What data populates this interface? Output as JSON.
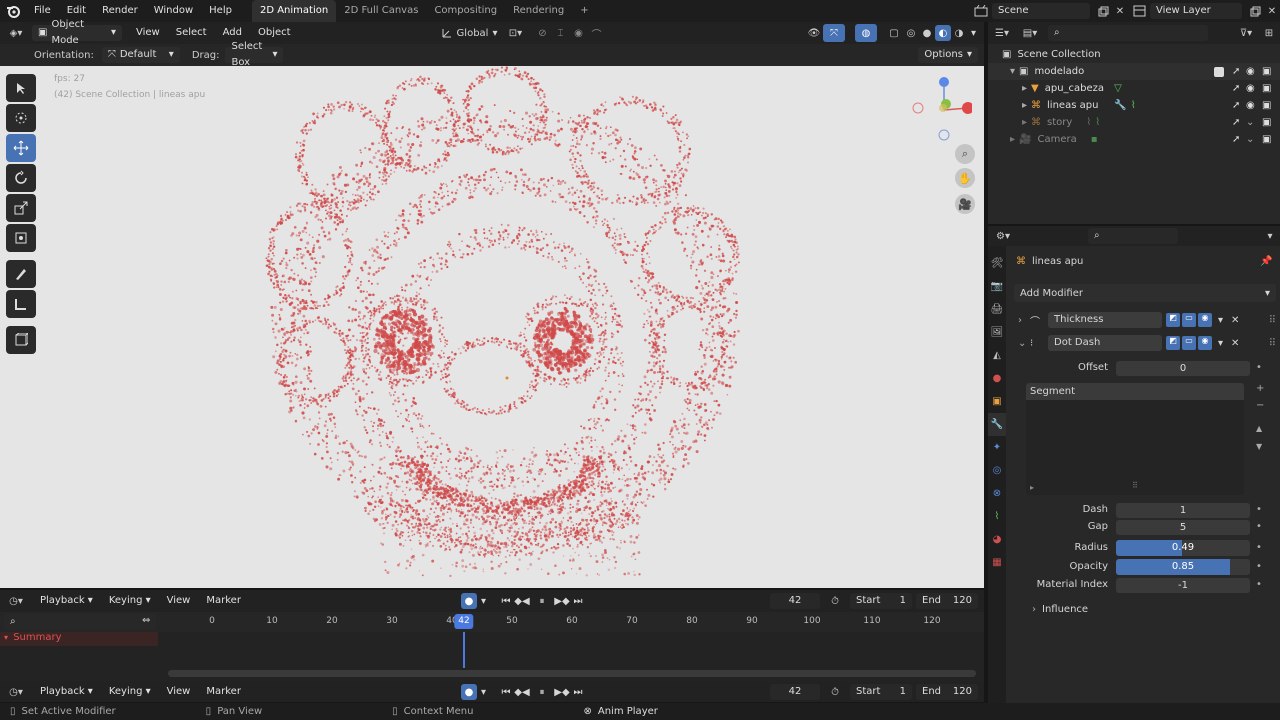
{
  "menu": {
    "items": [
      "File",
      "Edit",
      "Render",
      "Window",
      "Help"
    ]
  },
  "workspaces": {
    "tabs": [
      "2D Animation",
      "2D Full Canvas",
      "Compositing",
      "Rendering"
    ],
    "active": "2D Animation"
  },
  "scene": {
    "label": "Scene"
  },
  "view_layer": {
    "label": "View Layer"
  },
  "viewport": {
    "mode": "Object Mode",
    "menus": [
      "View",
      "Select",
      "Add",
      "Object"
    ],
    "transform_orientation": "Global",
    "orientation_label": "Orientation:",
    "orientation_value": "Default",
    "drag_label": "Drag:",
    "drag_value": "Select Box",
    "options_label": "Options",
    "fps": "fps: 27",
    "info": "(42) Scene Collection | lineas apu"
  },
  "outliner": {
    "items": [
      {
        "label": "Scene Collection"
      },
      {
        "label": "modelado"
      },
      {
        "label": "apu_cabeza"
      },
      {
        "label": "lineas apu"
      },
      {
        "label": "story"
      },
      {
        "label": "Camera"
      }
    ]
  },
  "properties": {
    "object_name": "lineas apu",
    "add_modifier": "Add Modifier",
    "modifiers": [
      {
        "name": "Thickness"
      },
      {
        "name": "Dot Dash"
      }
    ],
    "offset_label": "Offset",
    "offset_value": "0",
    "segment_label": "Segment",
    "fields": [
      {
        "label": "Dash",
        "value": "1"
      },
      {
        "label": "Gap",
        "value": "5"
      },
      {
        "label": "Radius",
        "value": "0.49"
      },
      {
        "label": "Opacity",
        "value": "0.85"
      },
      {
        "label": "Material Index",
        "value": "-1"
      }
    ],
    "radius_fraction": 0.49,
    "opacity_fraction": 0.85,
    "influence_label": "Influence"
  },
  "timeline": {
    "menus": [
      "Playback",
      "Keying",
      "View",
      "Marker"
    ],
    "current_frame": "42",
    "start_label": "Start",
    "start_value": "1",
    "end_label": "End",
    "end_value": "120",
    "ticks": [
      "0",
      "10",
      "20",
      "30",
      "40",
      "50",
      "60",
      "70",
      "80",
      "90",
      "100",
      "110",
      "120"
    ],
    "summary_label": "Summary"
  },
  "status_bar": {
    "items": [
      "Set Active Modifier",
      "Pan View",
      "Context Menu",
      "Anim Player"
    ]
  },
  "colors": {
    "accent": "#4772b3",
    "viewport_bg": "#e5e5e5",
    "stroke_red": "#d04848",
    "playhead": "#4a7ae0"
  }
}
